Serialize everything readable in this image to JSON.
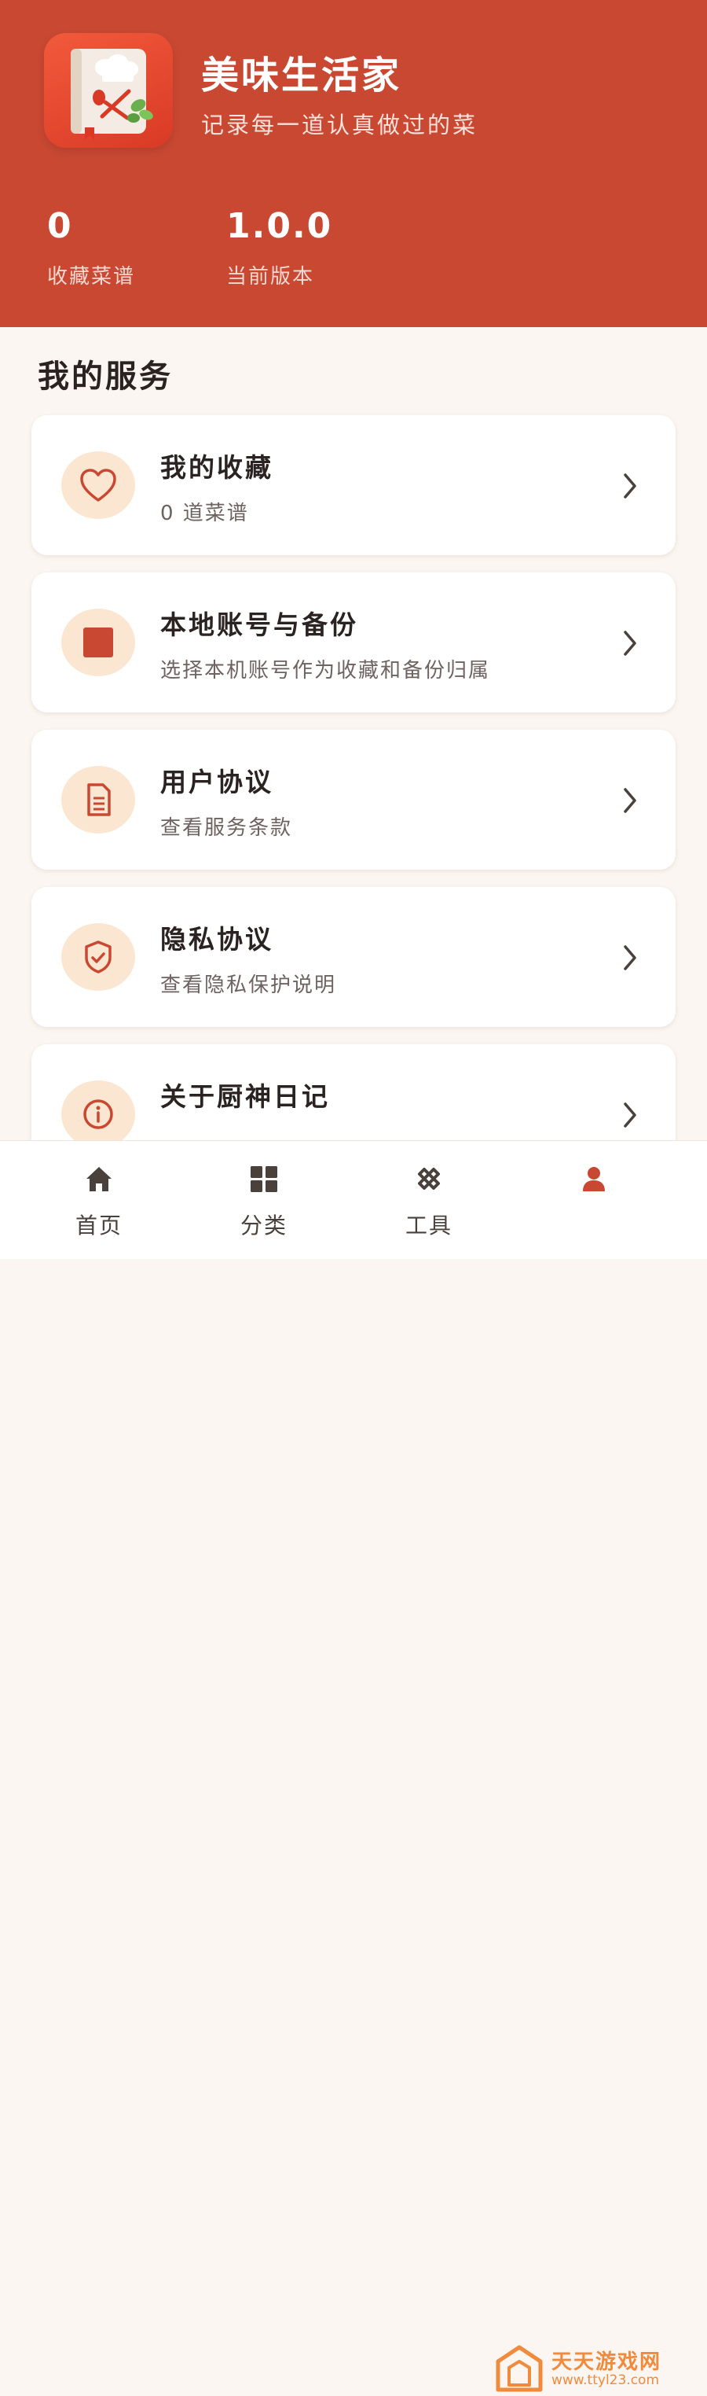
{
  "header": {
    "app_name": "美味生活家",
    "slogan": "记录每一道认真做过的菜",
    "app_icon": "recipe-book-icon",
    "stats": [
      {
        "value": "0",
        "label": "收藏菜谱"
      },
      {
        "value": "1.0.0",
        "label": "当前版本"
      }
    ]
  },
  "section": {
    "title": "我的服务"
  },
  "services": [
    {
      "title": "我的收藏",
      "subtitle": "0 道菜谱",
      "icon": "heart-icon"
    },
    {
      "title": "本地账号与备份",
      "subtitle": "选择本机账号作为收藏和备份归属",
      "icon": "square-icon"
    },
    {
      "title": "用户协议",
      "subtitle": "查看服务条款",
      "icon": "document-icon"
    },
    {
      "title": "隐私协议",
      "subtitle": "查看隐私保护说明",
      "icon": "shield-check-icon"
    },
    {
      "title": "关于厨神日记",
      "subtitle": "",
      "icon": "info-icon"
    }
  ],
  "tabbar": {
    "tabs": [
      {
        "label": "首页",
        "icon": "home-icon"
      },
      {
        "label": "分类",
        "icon": "grid-icon"
      },
      {
        "label": "工具",
        "icon": "tools-icon"
      },
      {
        "label": "",
        "icon": "profile-icon",
        "active": true
      }
    ]
  },
  "watermark": {
    "text": "天天游戏网",
    "url": "www.ttyl23.com"
  },
  "colors": {
    "brand": "#c94832",
    "background": "#fbf6f1",
    "icon_bg": "#fbe6d2",
    "accent_icon": "#c94832",
    "watermark": "#f08a3c"
  }
}
